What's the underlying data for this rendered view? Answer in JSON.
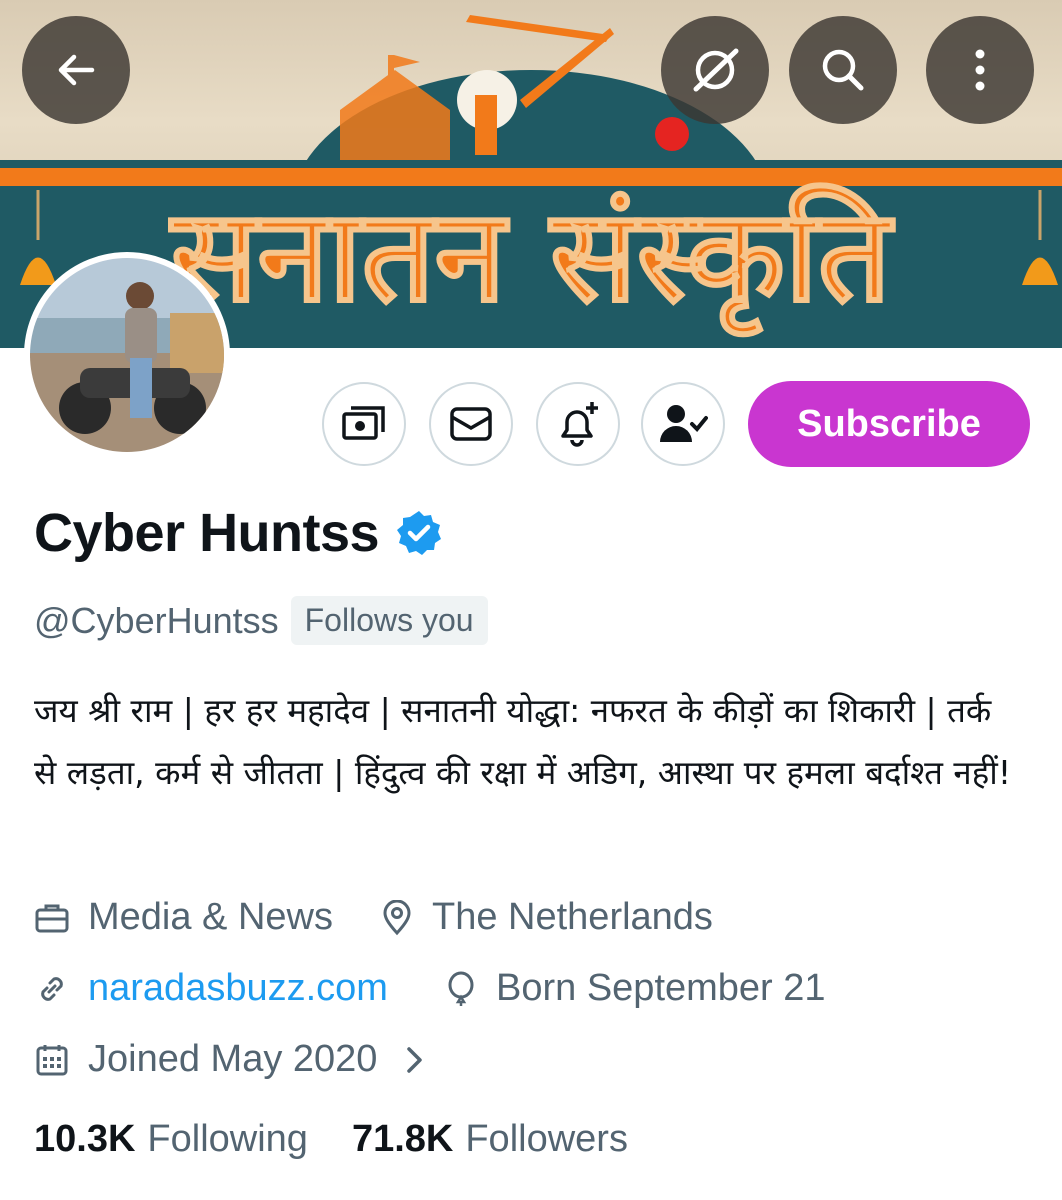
{
  "banner": {
    "text": "सनातन संस्कृति",
    "colors": {
      "orange": "#f27a1a",
      "teal": "#1f5a64",
      "red": "#e52421"
    }
  },
  "top_nav": {
    "back_icon": "arrow-left-icon",
    "grok_icon": "grok-slash-icon",
    "search_icon": "search-icon",
    "more_icon": "more-vertical-icon"
  },
  "actions": {
    "icons": [
      "money-icon",
      "mail-icon",
      "bell-plus-icon",
      "person-check-icon"
    ],
    "subscribe_label": "Subscribe",
    "subscribe_color": "#c936d0"
  },
  "profile": {
    "display_name": "Cyber Huntss",
    "verified": true,
    "verified_color": "#1d9bf0",
    "handle": "@CyberHuntss",
    "follows_you": "Follows you",
    "bio": "जय श्री राम | हर हर महादेव | सनातनी योद्धा: नफरत के कीड़ों का शिकारी | तर्क से लड़ता, कर्म से जीतता | हिंदुत्व की रक्षा में अडिग, आस्था पर हमला बर्दाश्त नहीं!",
    "category": "Media & News",
    "location": "The Netherlands",
    "website": "naradasbuzz.com",
    "birthday": "Born September 21",
    "joined": "Joined May 2020"
  },
  "stats": {
    "following_count": "10.3K",
    "following_label": "Following",
    "followers_count": "71.8K",
    "followers_label": "Followers"
  }
}
